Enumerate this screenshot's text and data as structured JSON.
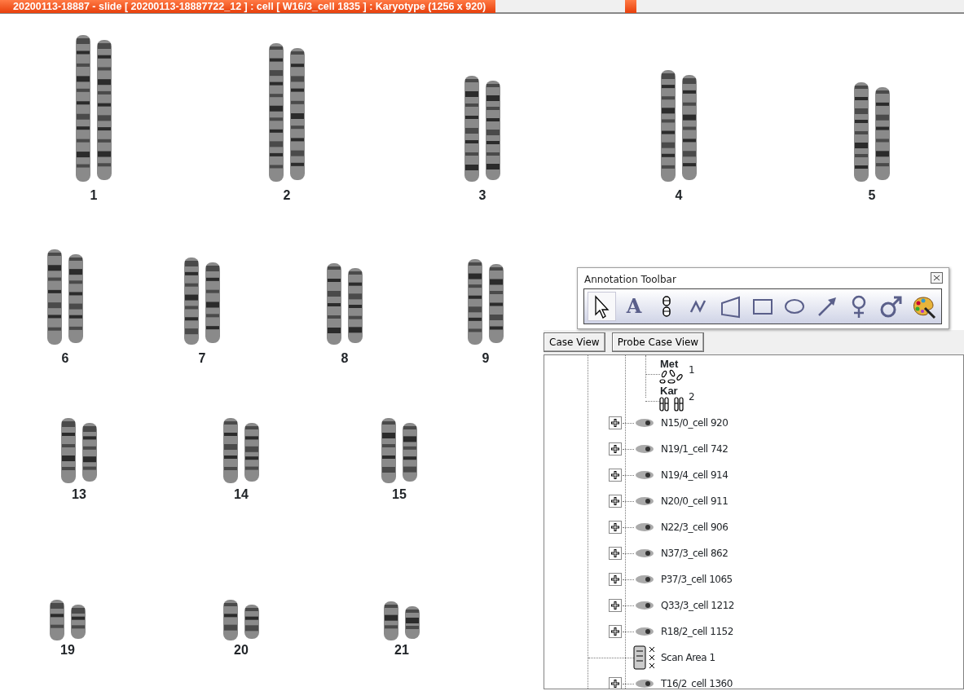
{
  "window": {
    "title": "20200113-18887 - slide [  20200113-18887722_12 ] : cell [ W16/3_cell 1835 ] : Karyotype  (1256 x 920)"
  },
  "karyotype": {
    "chromosomes": [
      {
        "label": "1"
      },
      {
        "label": "2"
      },
      {
        "label": "3"
      },
      {
        "label": "4"
      },
      {
        "label": "5"
      },
      {
        "label": "6"
      },
      {
        "label": "7"
      },
      {
        "label": "8"
      },
      {
        "label": "9"
      },
      {
        "label": "13"
      },
      {
        "label": "14"
      },
      {
        "label": "15"
      },
      {
        "label": "19"
      },
      {
        "label": "20"
      },
      {
        "label": "21"
      }
    ]
  },
  "annotation_toolbar": {
    "title": "Annotation Toolbar",
    "tools": [
      {
        "kind": "pointer",
        "selected": true
      },
      {
        "kind": "text",
        "glyph": "A",
        "selected": false
      },
      {
        "kind": "chromosome",
        "selected": false
      },
      {
        "kind": "freehand",
        "selected": false
      },
      {
        "kind": "polygon",
        "selected": false
      },
      {
        "kind": "rectangle",
        "selected": false
      },
      {
        "kind": "ellipse",
        "selected": false
      },
      {
        "kind": "arrow",
        "selected": false
      },
      {
        "kind": "female",
        "selected": false
      },
      {
        "kind": "male",
        "selected": false
      },
      {
        "kind": "palette",
        "selected": false
      }
    ]
  },
  "case_panel": {
    "buttons": [
      "Case View",
      "Probe Case View"
    ],
    "open_cell_images": [
      {
        "kind": "metaphase",
        "title": "Met",
        "label": "1"
      },
      {
        "kind": "karyotype",
        "title": "Kar",
        "label": "2"
      }
    ],
    "items": [
      {
        "kind": "cell",
        "label": "N15/0_cell 920",
        "expanded": false
      },
      {
        "kind": "cell",
        "label": "N19/1_cell 742",
        "expanded": false
      },
      {
        "kind": "cell",
        "label": "N19/4_cell 914",
        "expanded": false
      },
      {
        "kind": "cell",
        "label": "N20/0_cell 911",
        "expanded": false
      },
      {
        "kind": "cell",
        "label": "N22/3_cell 906",
        "expanded": false
      },
      {
        "kind": "cell",
        "label": "N37/3_cell 862",
        "expanded": false
      },
      {
        "kind": "cell",
        "label": "P37/3_cell 1065",
        "expanded": false
      },
      {
        "kind": "cell",
        "label": "Q33/3_cell 1212",
        "expanded": false
      },
      {
        "kind": "cell",
        "label": "R18/2_cell 1152",
        "expanded": false
      },
      {
        "kind": "scan_area",
        "label": "Scan Area 1"
      },
      {
        "kind": "cell",
        "label": "T16/2_cell 1360",
        "expanded": false
      }
    ]
  }
}
